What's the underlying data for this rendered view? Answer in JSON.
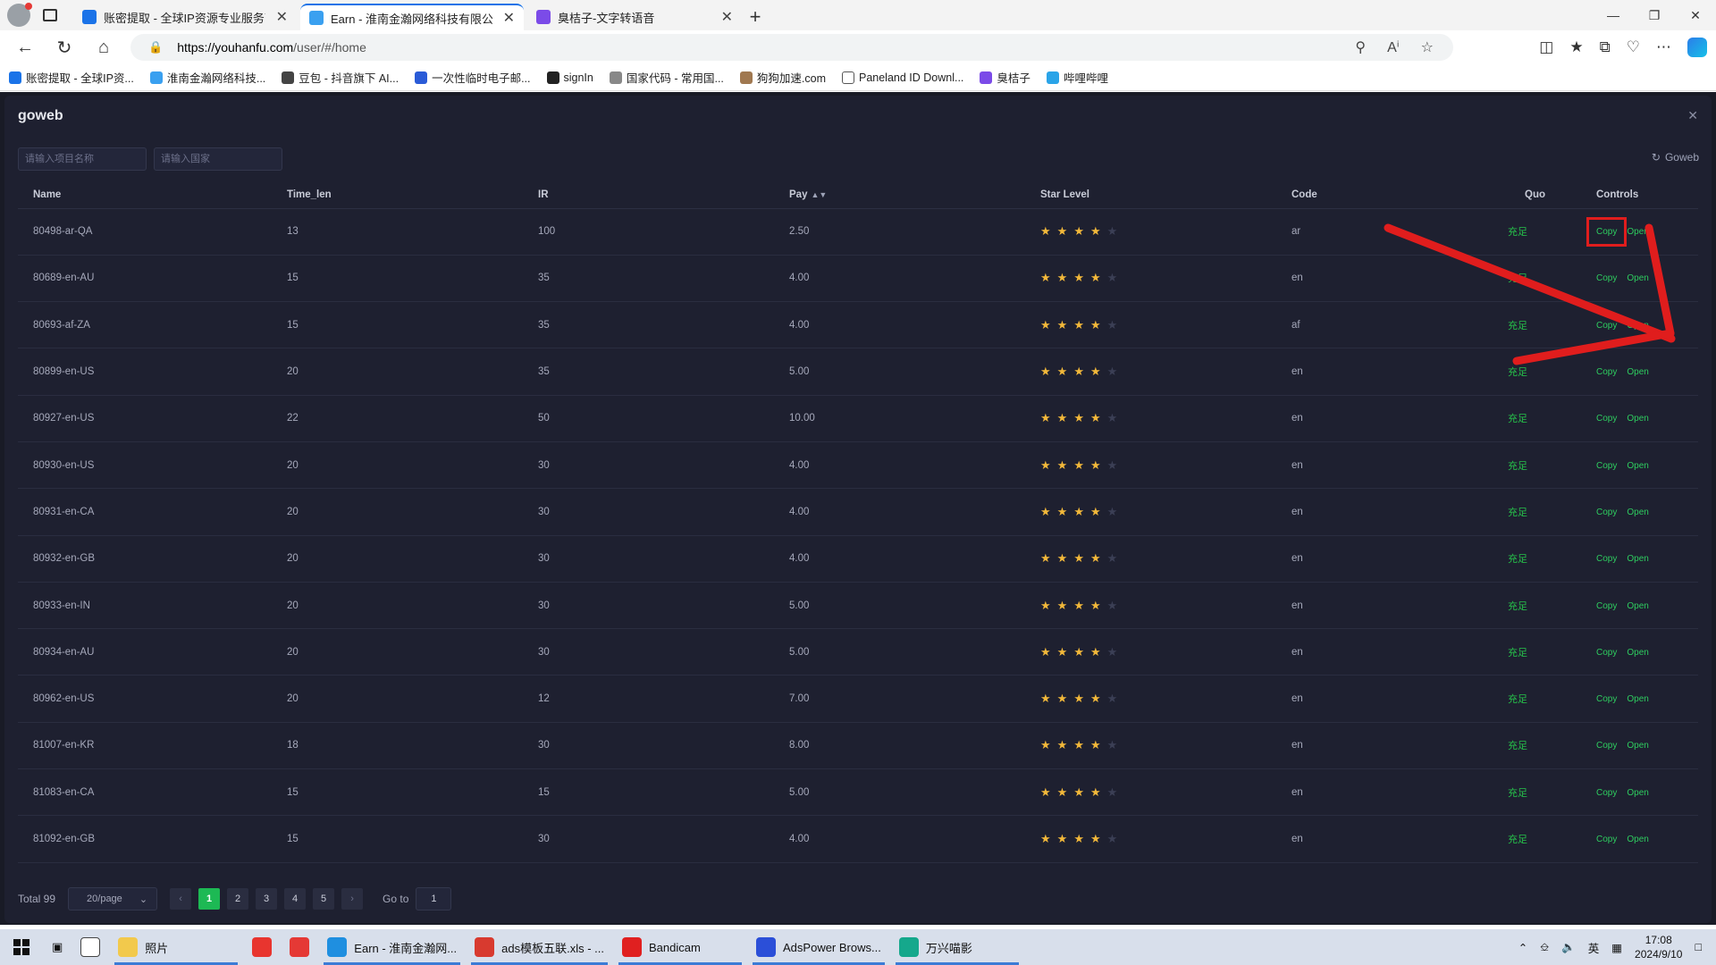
{
  "browser": {
    "tabs": [
      {
        "title": "账密提取 - 全球IP资源专业服务商",
        "favicon_color": "#1a73e8",
        "active": false
      },
      {
        "title": "Earn - 淮南金瀚网络科技有限公司",
        "favicon_color": "#3aa0f0",
        "active": true
      },
      {
        "title": "臭桔子-文字转语音",
        "favicon_color": "#7b4be8",
        "active": false
      }
    ],
    "url_host": "https://youhanfu.com",
    "url_path": "/user/#/home",
    "bookmarks": [
      {
        "label": "账密提取 - 全球IP资...",
        "color": "#1a73e8"
      },
      {
        "label": "淮南金瀚网络科技...",
        "color": "#3aa0f0"
      },
      {
        "label": "豆包 - 抖音旗下 AI...",
        "color": "#444444"
      },
      {
        "label": "一次性临时电子邮...",
        "color": "#2a5bd7"
      },
      {
        "label": "signIn",
        "color": "#222222"
      },
      {
        "label": "国家代码 - 常用国...",
        "color": "#888888"
      },
      {
        "label": "狗狗加速.com",
        "color": "#a07850"
      },
      {
        "label": "Paneland ID Downl...",
        "color": "#ffffff"
      },
      {
        "label": "臭桔子",
        "color": "#7b4be8"
      },
      {
        "label": "哔哩哔哩",
        "color": "#2aa4e8"
      }
    ]
  },
  "panel": {
    "title": "goweb",
    "close_icon": "close-icon",
    "filter_name_placeholder": "请输入项目名称",
    "filter_country_placeholder": "请输入国家",
    "goweb_button": "Goweb"
  },
  "table": {
    "headers": {
      "name": "Name",
      "time_len": "Time_len",
      "ir": "IR",
      "pay": "Pay",
      "star": "Star Level",
      "code": "Code",
      "quota": "Quo",
      "controls": "Controls"
    },
    "copy_label": "Copy",
    "open_label": "Open",
    "quota_label": "充足",
    "rows": [
      {
        "name": "80498-ar-QA",
        "time_len": "13",
        "ir": "100",
        "pay": "2.50",
        "stars": 4,
        "code": "ar"
      },
      {
        "name": "80689-en-AU",
        "time_len": "15",
        "ir": "35",
        "pay": "4.00",
        "stars": 4,
        "code": "en"
      },
      {
        "name": "80693-af-ZA",
        "time_len": "15",
        "ir": "35",
        "pay": "4.00",
        "stars": 4,
        "code": "af"
      },
      {
        "name": "80899-en-US",
        "time_len": "20",
        "ir": "35",
        "pay": "5.00",
        "stars": 4,
        "code": "en"
      },
      {
        "name": "80927-en-US",
        "time_len": "22",
        "ir": "50",
        "pay": "10.00",
        "stars": 4,
        "code": "en"
      },
      {
        "name": "80930-en-US",
        "time_len": "20",
        "ir": "30",
        "pay": "4.00",
        "stars": 4,
        "code": "en"
      },
      {
        "name": "80931-en-CA",
        "time_len": "20",
        "ir": "30",
        "pay": "4.00",
        "stars": 4,
        "code": "en"
      },
      {
        "name": "80932-en-GB",
        "time_len": "20",
        "ir": "30",
        "pay": "4.00",
        "stars": 4,
        "code": "en"
      },
      {
        "name": "80933-en-IN",
        "time_len": "20",
        "ir": "30",
        "pay": "5.00",
        "stars": 4,
        "code": "en"
      },
      {
        "name": "80934-en-AU",
        "time_len": "20",
        "ir": "30",
        "pay": "5.00",
        "stars": 4,
        "code": "en"
      },
      {
        "name": "80962-en-US",
        "time_len": "20",
        "ir": "12",
        "pay": "7.00",
        "stars": 4,
        "code": "en"
      },
      {
        "name": "81007-en-KR",
        "time_len": "18",
        "ir": "30",
        "pay": "8.00",
        "stars": 4,
        "code": "en"
      },
      {
        "name": "81083-en-CA",
        "time_len": "15",
        "ir": "15",
        "pay": "5.00",
        "stars": 4,
        "code": "en"
      },
      {
        "name": "81092-en-GB",
        "time_len": "15",
        "ir": "30",
        "pay": "4.00",
        "stars": 4,
        "code": "en"
      }
    ]
  },
  "pagination": {
    "total": "Total 99",
    "page_size": "20/page",
    "pages": [
      "1",
      "2",
      "3",
      "4",
      "5"
    ],
    "active_page": "1",
    "goto_label": "Go to",
    "goto_value": "1"
  },
  "taskbar": {
    "items": [
      {
        "label": "",
        "color": "#ffffff"
      },
      {
        "label": "照片",
        "color": "#f2c94c"
      },
      {
        "label": "",
        "color": "#e8352f"
      },
      {
        "label": "",
        "color": "#e53935"
      },
      {
        "label": "Earn - 淮南金瀚网...",
        "color": "#1f8fe0"
      },
      {
        "label": "ads模板五联.xls - ...",
        "color": "#d83a2f"
      },
      {
        "label": "Bandicam",
        "color": "#e02020"
      },
      {
        "label": "AdsPower Brows...",
        "color": "#2b4fd8"
      },
      {
        "label": "万兴喵影",
        "color": "#15a88c"
      }
    ],
    "tray_lang": "英",
    "time": "17:08",
    "date": "2024/9/10"
  },
  "colors": {
    "accent_green": "#1db954",
    "annotation_red": "#e01d1d",
    "star": "#f2b83a"
  }
}
